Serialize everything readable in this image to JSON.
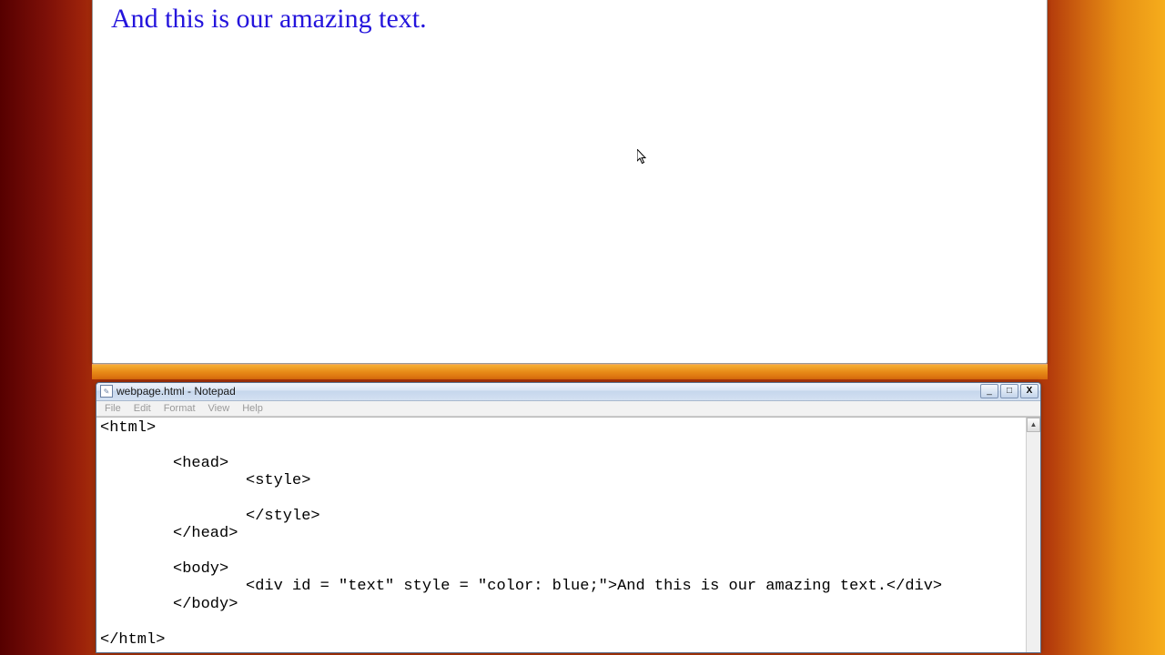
{
  "browser": {
    "rendered_text": "And this is our amazing text."
  },
  "notepad": {
    "title": "webpage.html - Notepad",
    "menu": {
      "file": "File",
      "edit": "Edit",
      "format": "Format",
      "view": "View",
      "help": "Help"
    },
    "code": {
      "l1": "<html>",
      "l2": "<head>",
      "l3": "<style>",
      "l4": "</style>",
      "l5": "</head>",
      "l6": "<body>",
      "l7": "<div id = \"text\" style = \"color: blue;\">And this is our amazing text.</div>",
      "l8": "</body>",
      "l9": "</html>"
    },
    "controls": {
      "minimize": "_",
      "maximize": "□",
      "close": "X"
    },
    "scroll": {
      "up": "▲",
      "down": "▼"
    }
  }
}
